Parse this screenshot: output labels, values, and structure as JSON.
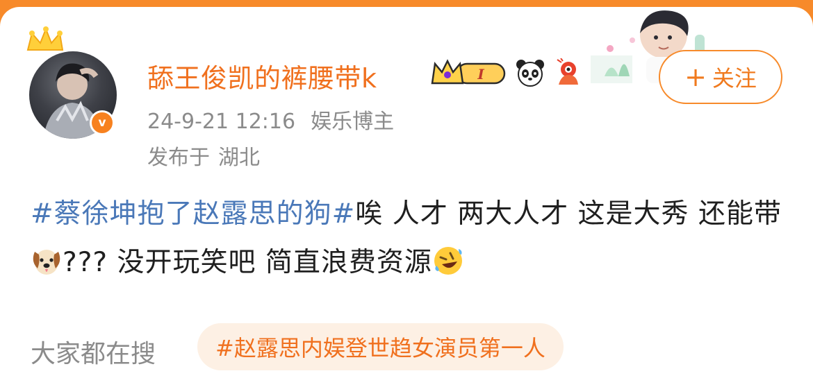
{
  "post": {
    "author": {
      "username": "舔王俊凯的裤腰带k",
      "verified_label": "v",
      "level_badge": "I"
    },
    "timestamp": "24-9-21 12:16",
    "author_title": "娱乐博主",
    "location_prefix": "发布于",
    "location": "湖北",
    "follow_button": {
      "plus": "+",
      "label": "关注"
    },
    "hashtag": "#蔡徐坤抱了赵露思的狗#",
    "text_part1": "唉 人才 两大人才 这是大秀 还能带",
    "text_part2": "??? 没开玩笑吧 简直浪费资源",
    "icons": {
      "crown": "crown-icon",
      "level": "level-badge-icon",
      "panda": "panda-icon",
      "mascot": "mascot-icon",
      "dog": "dog-face-emoji",
      "laugh": "rofl-emoji"
    }
  },
  "hot_search": {
    "label": "大家都在搜",
    "topic": "#赵露思内娱登世趋女演员第一人"
  },
  "colors": {
    "brand_orange": "#f78a2a",
    "username": "#f0701e",
    "hashtag": "#4a78b8",
    "meta_gray": "#8b8b8b"
  }
}
